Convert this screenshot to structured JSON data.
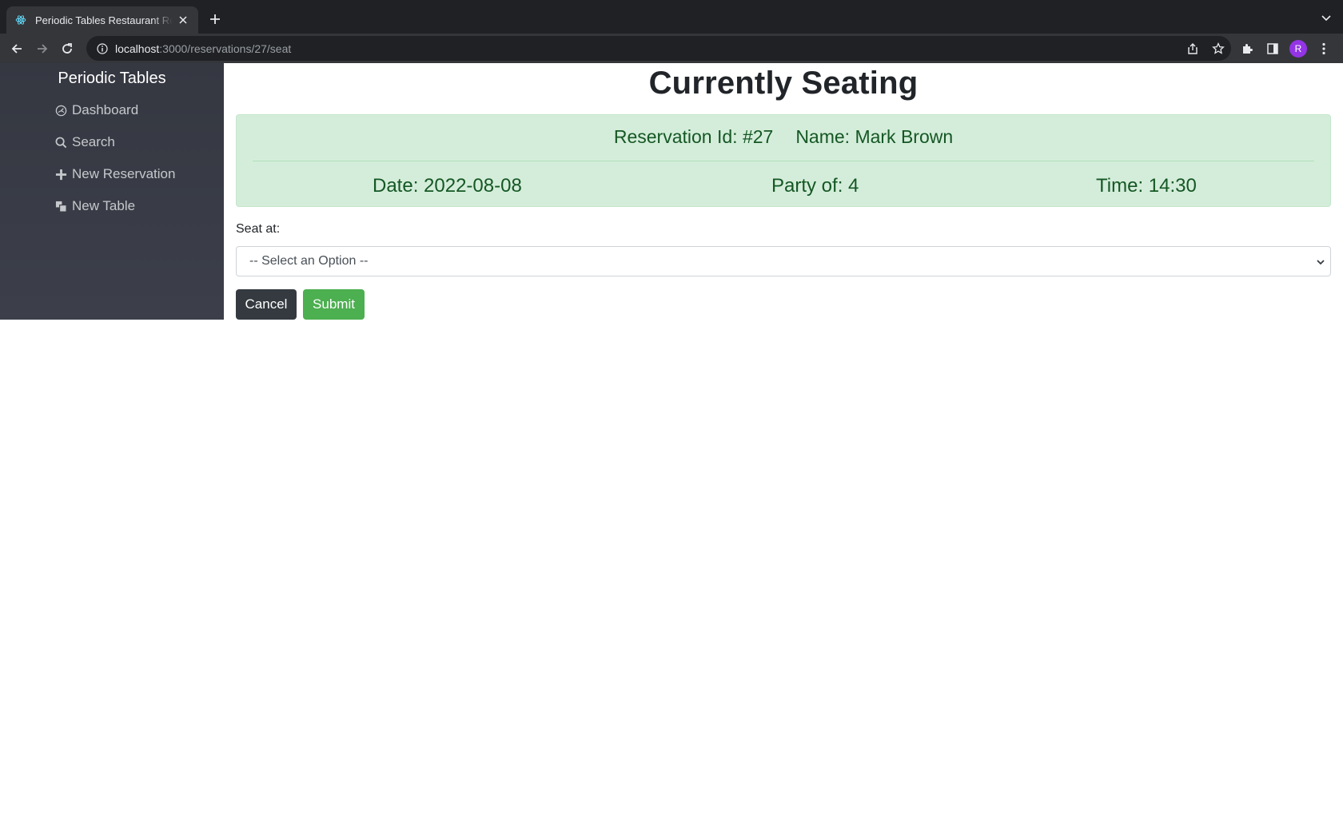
{
  "browser": {
    "tab_title": "Periodic Tables Restaurant Reservation",
    "url_host": "localhost",
    "url_path": ":3000/reservations/27/seat",
    "avatar_letter": "R"
  },
  "sidebar": {
    "brand": "Periodic Tables",
    "items": [
      {
        "label": "Dashboard",
        "icon": "dashboard-icon"
      },
      {
        "label": "Search",
        "icon": "search-icon"
      },
      {
        "label": "New Reservation",
        "icon": "plus-icon"
      },
      {
        "label": "New Table",
        "icon": "layers-icon"
      }
    ]
  },
  "main": {
    "title": "Currently Seating",
    "reservation": {
      "id_label": "Reservation Id: #27",
      "name_label": "Name: Mark Brown",
      "date_label": "Date: 2022-08-08",
      "party_label": "Party of: 4",
      "time_label": "Time: 14:30"
    },
    "seat_label": "Seat at:",
    "select_value": "-- Select an Option --",
    "cancel_label": "Cancel",
    "submit_label": "Submit"
  },
  "colors": {
    "alert_bg": "#d4edda",
    "alert_text": "#155724",
    "sidebar_bg": "#353841",
    "submit_bg": "#4caf50",
    "cancel_bg": "#343a40"
  }
}
